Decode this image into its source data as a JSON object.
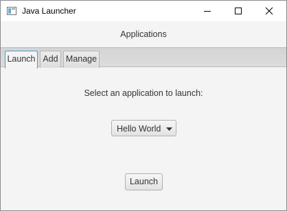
{
  "window": {
    "title": "Java Launcher",
    "app_icon": "java-app-icon",
    "controls": {
      "minimize_icon": "minimize-icon",
      "maximize_icon": "maximize-icon",
      "close_icon": "close-icon"
    }
  },
  "header": {
    "title": "Applications"
  },
  "tabs": [
    {
      "label": "Launch",
      "active": true
    },
    {
      "label": "Add",
      "active": false
    },
    {
      "label": "Manage",
      "active": false
    }
  ],
  "launch_panel": {
    "prompt": "Select an application to launch:",
    "selected_application": "Hello World",
    "launch_label": "Launch"
  },
  "colors": {
    "background": "#f4f4f4",
    "active_tab_border": "#3aa0d8",
    "text": "#333333"
  }
}
